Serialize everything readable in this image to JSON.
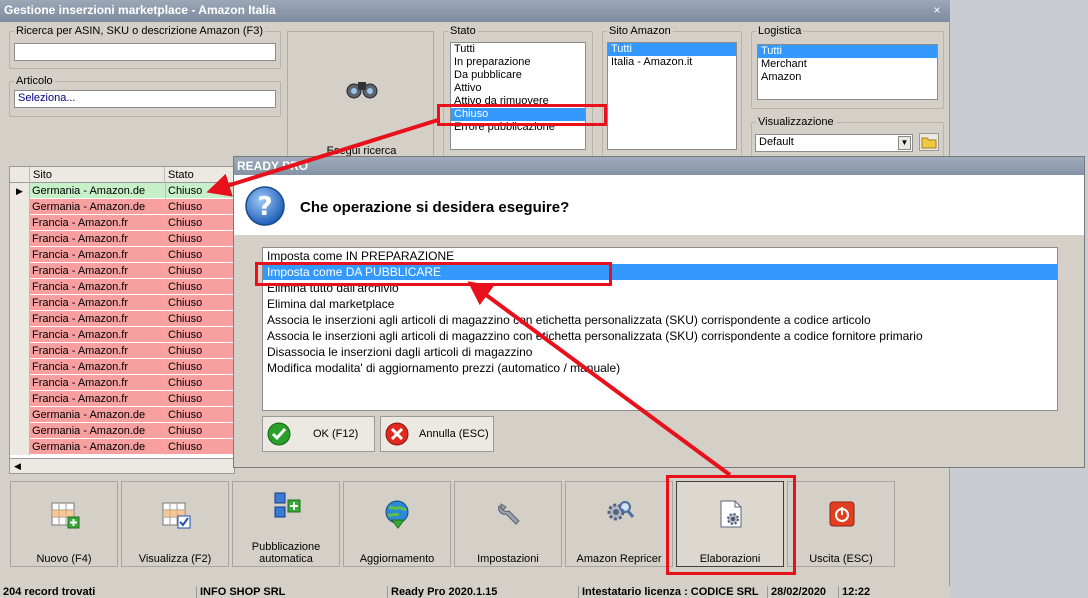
{
  "window": {
    "title": "Gestione inserzioni marketplace - Amazon Italia",
    "close": "×"
  },
  "search": {
    "label": "Ricerca per ASIN, SKU o descrizione Amazon (F3)",
    "value": ""
  },
  "articolo": {
    "label": "Articolo",
    "value": "Seleziona..."
  },
  "search_button": {
    "label": "Esegui ricerca",
    "icon": "binoculars-icon"
  },
  "stato": {
    "label": "Stato",
    "items": [
      "Tutti",
      "In preparazione",
      "Da pubblicare",
      "Attivo",
      "Attivo da rimuovere",
      "Chiuso",
      "Errore pubblicazione"
    ],
    "selected": "Chiuso"
  },
  "sito_amazon": {
    "label": "Sito Amazon",
    "items": [
      "Tutti",
      "Italia - Amazon.it"
    ],
    "selected": "Tutti"
  },
  "logistica": {
    "label": "Logistica",
    "items": [
      "Tutti",
      "Merchant",
      "Amazon"
    ],
    "selected": "Tutti"
  },
  "visualizzazione": {
    "label": "Visualizzazione",
    "value": "Default"
  },
  "grid": {
    "columns": [
      "Sito",
      "Stato"
    ],
    "rows": [
      {
        "sito": "Germania - Amazon.de",
        "stato": "Chiuso"
      },
      {
        "sito": "Germania - Amazon.de",
        "stato": "Chiuso"
      },
      {
        "sito": "Francia - Amazon.fr",
        "stato": "Chiuso"
      },
      {
        "sito": "Francia - Amazon.fr",
        "stato": "Chiuso"
      },
      {
        "sito": "Francia - Amazon.fr",
        "stato": "Chiuso"
      },
      {
        "sito": "Francia - Amazon.fr",
        "stato": "Chiuso"
      },
      {
        "sito": "Francia - Amazon.fr",
        "stato": "Chiuso"
      },
      {
        "sito": "Francia - Amazon.fr",
        "stato": "Chiuso"
      },
      {
        "sito": "Francia - Amazon.fr",
        "stato": "Chiuso"
      },
      {
        "sito": "Francia - Amazon.fr",
        "stato": "Chiuso"
      },
      {
        "sito": "Francia - Amazon.fr",
        "stato": "Chiuso"
      },
      {
        "sito": "Francia - Amazon.fr",
        "stato": "Chiuso"
      },
      {
        "sito": "Francia - Amazon.fr",
        "stato": "Chiuso"
      },
      {
        "sito": "Francia - Amazon.fr",
        "stato": "Chiuso"
      },
      {
        "sito": "Germania - Amazon.de",
        "stato": "Chiuso"
      },
      {
        "sito": "Germania - Amazon.de",
        "stato": "Chiuso"
      },
      {
        "sito": "Germania - Amazon.de",
        "stato": "Chiuso"
      }
    ]
  },
  "toolbar": {
    "nuovo": "Nuovo (F4)",
    "visualizza": "Visualizza (F2)",
    "pubblicazione_1": "Pubblicazione",
    "pubblicazione_2": "automatica",
    "aggiornamento": "Aggiornamento",
    "impostazioni": "Impostazioni",
    "repricer": "Amazon Repricer",
    "elaborazioni": "Elaborazioni",
    "uscita": "Uscita (ESC)"
  },
  "statusbar": {
    "records": "204 record trovati",
    "company": "INFO SHOP SRL",
    "version": "Ready Pro 2020.1.15",
    "license": "Intestatario licenza : CODICE SRL",
    "date": "28/02/2020",
    "time": "12:22"
  },
  "dialog": {
    "title": "READY PRO",
    "question": "Che operazione si desidera eseguire?",
    "options": [
      "Imposta come IN PREPARAZIONE",
      "Imposta come DA PUBBLICARE",
      "Elimina tutto dall'archivio",
      "Elimina dal marketplace",
      "Associa le inserzioni agli articoli di magazzino con etichetta personalizzata (SKU) corrispondente a codice articolo",
      "Associa le inserzioni agli articoli di magazzino con etichetta personalizzata (SKU) corrispondente a codice fornitore primario",
      "Disassocia le inserzioni dagli articoli di magazzino",
      "Modifica modalita' di aggiornamento prezzi (automatico / manuale)"
    ],
    "selected_index": 1,
    "ok_label": "OK (F12)",
    "cancel_label": "Annulla (ESC)"
  },
  "colors": {
    "closed_row": "#f8a0a0",
    "current_row": "#c8f0c8",
    "selection": "#3399ff",
    "annotation": "#e8101a"
  }
}
